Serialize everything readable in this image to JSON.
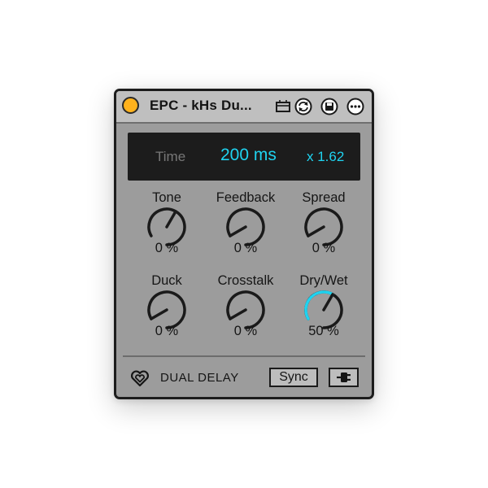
{
  "device": {
    "title": "EPC - kHs Du...",
    "brand": "DUAL DELAY",
    "icons": [
      "power-icon",
      "clip-icon",
      "sync-icon",
      "save-icon",
      "more-icon",
      "heart-logo-icon",
      "plug-icon"
    ]
  },
  "display": {
    "label": "Time",
    "value": "200 ms",
    "multiplier": "x 1.62"
  },
  "knobs": [
    {
      "label": "Tone",
      "value": "0 %",
      "position": 0.5
    },
    {
      "label": "Feedback",
      "value": "0 %",
      "position": 0.0
    },
    {
      "label": "Spread",
      "value": "0 %",
      "position": 0.0
    },
    {
      "label": "Duck",
      "value": "0 %",
      "position": 0.0
    },
    {
      "label": "Crosstalk",
      "value": "0 %",
      "position": 0.0
    },
    {
      "label": "Dry/Wet",
      "value": "50 %",
      "position": 0.5,
      "active": true
    }
  ],
  "buttons": {
    "sync_label": "Sync"
  },
  "colors": {
    "accent": "#1fd3f0",
    "power": "#ffb21d",
    "panel": "#9c9c9c",
    "display_bg": "#1c1c1c"
  }
}
